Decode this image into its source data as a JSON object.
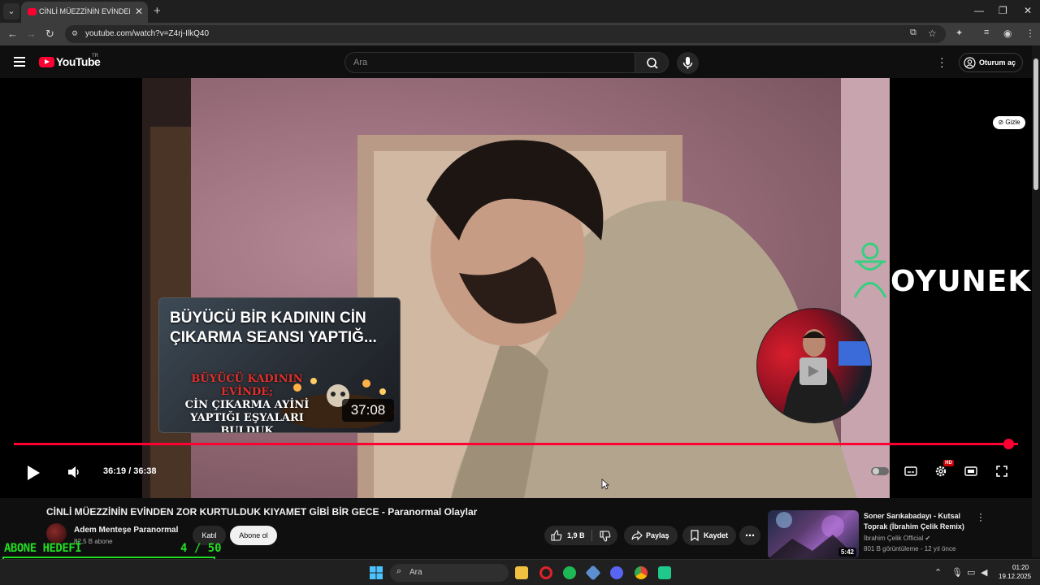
{
  "browser": {
    "tab_title": "CİNLİ MÜEZZİNİN EVİNDEN ZOR",
    "url": "youtube.com/watch?v=Z4rj-IlkQ40",
    "new_tab_glyph": "+",
    "close_glyph": "✕"
  },
  "youtube": {
    "logo_text": "YouTube",
    "country": "TR",
    "search_placeholder": "Ara",
    "signin_label": "Oturum aç"
  },
  "player": {
    "gizle_label": "Gizle",
    "brand_logo": "OYUNEKS",
    "end_card_title": "BÜYÜCÜ BİR KADININ CİN ÇIKARMA SEANSI YAPTIĞ...",
    "end_card_thumb_line1": "BÜYÜCÜ KADININ EVİNDE;",
    "end_card_thumb_line2": "CİN ÇIKARMA AYİNİ",
    "end_card_thumb_line3": "YAPTIĞI EŞYALARI",
    "end_card_thumb_line4": "BULDUK",
    "end_card_duration": "37:08",
    "time_display": "36:19 / 36:38",
    "progress": 0.991,
    "hd_badge": "HD"
  },
  "video": {
    "title": "CİNLİ MÜEZZİNİN EVİNDEN ZOR KURTULDUK KIYAMET GİBİ BİR GECE - Paranormal Olaylar",
    "channel_name": "Adem Menteşe Paranormal",
    "subscribers": "82,5 B abone",
    "join_label": "Katıl",
    "subscribe_label": "Abone ol",
    "likes": "1,9 B",
    "share_label": "Paylaş",
    "save_label": "Kaydet"
  },
  "recommendation": {
    "title": "Soner Sarıkabadayı - Kutsal Toprak (İbrahim Çelik Remix)",
    "channel": "İbrahim Çelik Official",
    "meta": "801 B görüntüleme - 12 yıl önce",
    "duration": "5:42"
  },
  "overlay": {
    "label": "ABONE HEDEFİ",
    "count": "4  / 50",
    "current": 4,
    "goal": 50
  },
  "taskbar": {
    "search_label": "Ara",
    "time": "01:20",
    "date": "19.12.2025"
  }
}
